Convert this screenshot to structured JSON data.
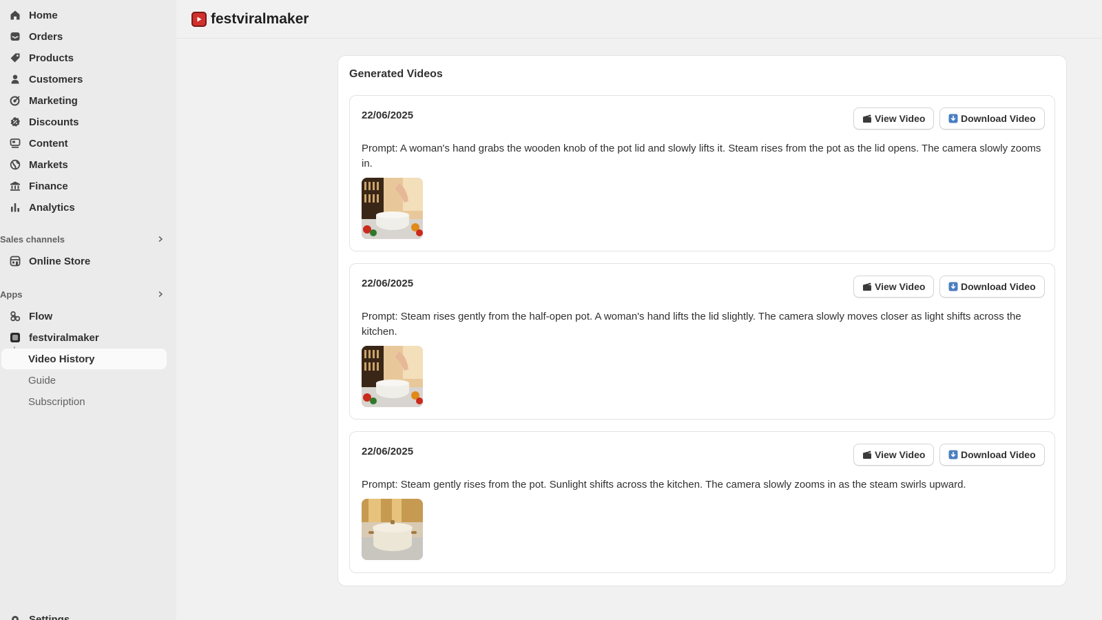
{
  "app": {
    "name": "festviralmaker",
    "logo_color": "#d0312d"
  },
  "sidebar": {
    "main_items": [
      {
        "label": "Home",
        "icon": "home-icon"
      },
      {
        "label": "Orders",
        "icon": "inbox-icon"
      },
      {
        "label": "Products",
        "icon": "tag-icon"
      },
      {
        "label": "Customers",
        "icon": "person-icon"
      },
      {
        "label": "Marketing",
        "icon": "target-icon"
      },
      {
        "label": "Discounts",
        "icon": "discount-icon"
      },
      {
        "label": "Content",
        "icon": "content-icon"
      },
      {
        "label": "Markets",
        "icon": "globe-icon"
      },
      {
        "label": "Finance",
        "icon": "bank-icon"
      },
      {
        "label": "Analytics",
        "icon": "bar-chart-icon"
      }
    ],
    "sales_channels": {
      "title": "Sales channels",
      "items": [
        {
          "label": "Online Store",
          "icon": "store-icon"
        }
      ]
    },
    "apps": {
      "title": "Apps",
      "items": [
        {
          "label": "Flow",
          "icon": "flow-icon"
        },
        {
          "label": "festviralmaker",
          "icon": "app-icon"
        }
      ],
      "sub_items": [
        {
          "label": "Video History",
          "active": true
        },
        {
          "label": "Guide"
        },
        {
          "label": "Subscription"
        }
      ]
    },
    "settings_label": "Settings"
  },
  "main": {
    "title": "Generated Videos",
    "videos": [
      {
        "date": "22/06/2025",
        "view_label": "View Video",
        "download_label": "Download Video",
        "prompt": "Prompt: A woman's hand grabs the wooden knob of the pot lid and slowly lifts it. Steam rises from the pot as the lid opens. The camera slowly zooms in."
      },
      {
        "date": "22/06/2025",
        "view_label": "View Video",
        "download_label": "Download Video",
        "prompt": "Prompt: Steam rises gently from the half-open pot. A woman's hand lifts the lid slightly. The camera slowly moves closer as light shifts across the kitchen."
      },
      {
        "date": "22/06/2025",
        "view_label": "View Video",
        "download_label": "Download Video",
        "prompt": "Prompt: Steam gently rises from the pot. Sunlight shifts across the kitchen. The camera slowly zooms in as the steam swirls upward."
      }
    ]
  },
  "colors": {
    "sidebar_bg": "#ebebeb",
    "page_bg": "#f1f1f1",
    "card_bg": "#ffffff",
    "text": "#303030",
    "muted_text": "#616161"
  }
}
